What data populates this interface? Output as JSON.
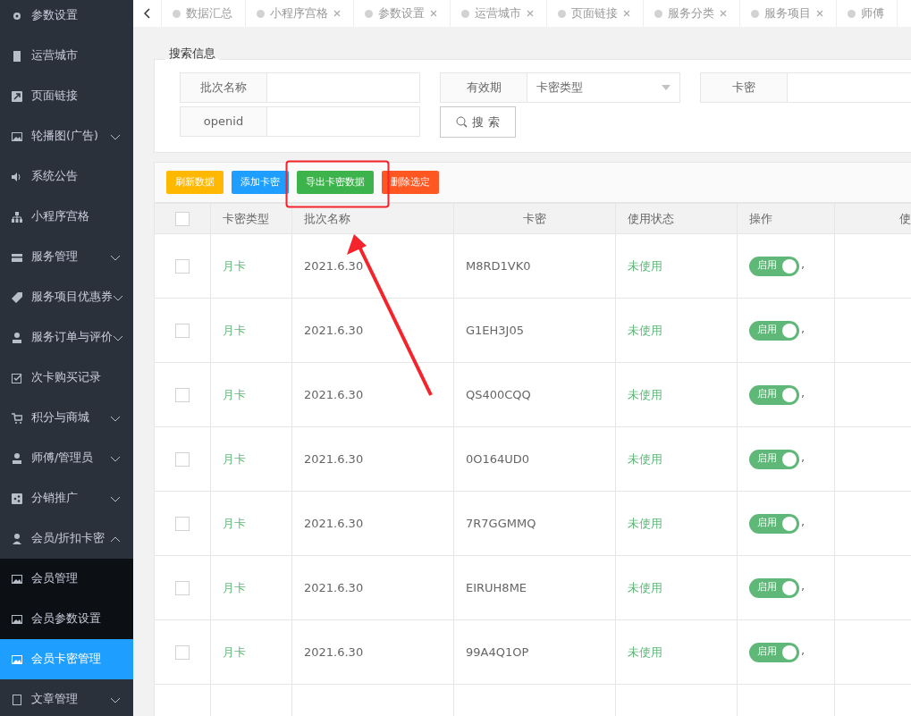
{
  "sidebar": {
    "items": [
      {
        "label": "参数设置"
      },
      {
        "label": "运营城市"
      },
      {
        "label": "页面链接"
      },
      {
        "label": "轮播图(广告)",
        "expanded": false
      },
      {
        "label": "系统公告"
      },
      {
        "label": "小程序宫格"
      },
      {
        "label": "服务管理",
        "expanded": false
      },
      {
        "label": "服务项目优惠券",
        "expanded": false
      },
      {
        "label": "服务订单与评价",
        "expanded": false
      },
      {
        "label": "次卡购买记录"
      },
      {
        "label": "积分与商城",
        "expanded": false
      },
      {
        "label": "师傅/管理员",
        "expanded": false
      },
      {
        "label": "分销推广",
        "expanded": false
      },
      {
        "label": "会员/折扣卡密",
        "expanded": true,
        "children": [
          {
            "label": "会员管理",
            "selected": false
          },
          {
            "label": "会员参数设置",
            "selected": false
          },
          {
            "label": "会员卡密管理",
            "selected": true
          }
        ]
      },
      {
        "label": "文章管理",
        "expanded": false
      }
    ]
  },
  "tabs": [
    {
      "label": "数据汇总",
      "closable": false
    },
    {
      "label": "小程序宫格",
      "closable": true
    },
    {
      "label": "参数设置",
      "closable": true
    },
    {
      "label": "运营城市",
      "closable": true
    },
    {
      "label": "页面链接",
      "closable": true
    },
    {
      "label": "服务分类",
      "closable": true
    },
    {
      "label": "服务项目",
      "closable": true
    },
    {
      "label": "师傅",
      "closable": false
    }
  ],
  "search": {
    "legend": "搜索信息",
    "fields": [
      {
        "kind": "input",
        "label": "批次名称"
      },
      {
        "kind": "select",
        "label": "有效期",
        "value": "卡密类型"
      },
      {
        "kind": "input",
        "label": "卡密"
      },
      {
        "kind": "input",
        "label": "openid"
      },
      {
        "kind": "button",
        "label": "搜 索"
      }
    ]
  },
  "toolbar": [
    {
      "label": "刷新数据",
      "color": "#ffb800"
    },
    {
      "label": "添加卡密",
      "color": "#1e9fff"
    },
    {
      "label": "导出卡密数据",
      "color": "#3cb44b"
    },
    {
      "label": "删除选定",
      "color": "#ff5722"
    }
  ],
  "table": {
    "select_all_checked": false,
    "columns": [
      "卡密类型",
      "批次名称",
      "卡密",
      "使用状态",
      "操作",
      "使"
    ],
    "rows": [
      {
        "type": "月卡",
        "batch": "2021.6.30",
        "code": "M8RD1VK0",
        "status": "未使用",
        "toggle_label": "启用",
        "after_toggle": ",",
        "on": true,
        "checked": false
      },
      {
        "type": "月卡",
        "batch": "2021.6.30",
        "code": "G1EH3J05",
        "status": "未使用",
        "toggle_label": "启用",
        "after_toggle": ",",
        "on": true,
        "checked": false
      },
      {
        "type": "月卡",
        "batch": "2021.6.30",
        "code": "QS400CQQ",
        "status": "未使用",
        "toggle_label": "启用",
        "after_toggle": ",",
        "on": true,
        "checked": false
      },
      {
        "type": "月卡",
        "batch": "2021.6.30",
        "code": "0O164UD0",
        "status": "未使用",
        "toggle_label": "启用",
        "after_toggle": ",",
        "on": true,
        "checked": false
      },
      {
        "type": "月卡",
        "batch": "2021.6.30",
        "code": "7R7GGMMQ",
        "status": "未使用",
        "toggle_label": "启用",
        "after_toggle": ",",
        "on": true,
        "checked": false
      },
      {
        "type": "月卡",
        "batch": "2021.6.30",
        "code": "EIRUH8ME",
        "status": "未使用",
        "toggle_label": "启用",
        "after_toggle": ",",
        "on": true,
        "checked": false
      },
      {
        "type": "月卡",
        "batch": "2021.6.30",
        "code": "99A4Q1OP",
        "status": "未使用",
        "toggle_label": "启用",
        "after_toggle": ",",
        "on": true,
        "checked": false
      }
    ]
  }
}
